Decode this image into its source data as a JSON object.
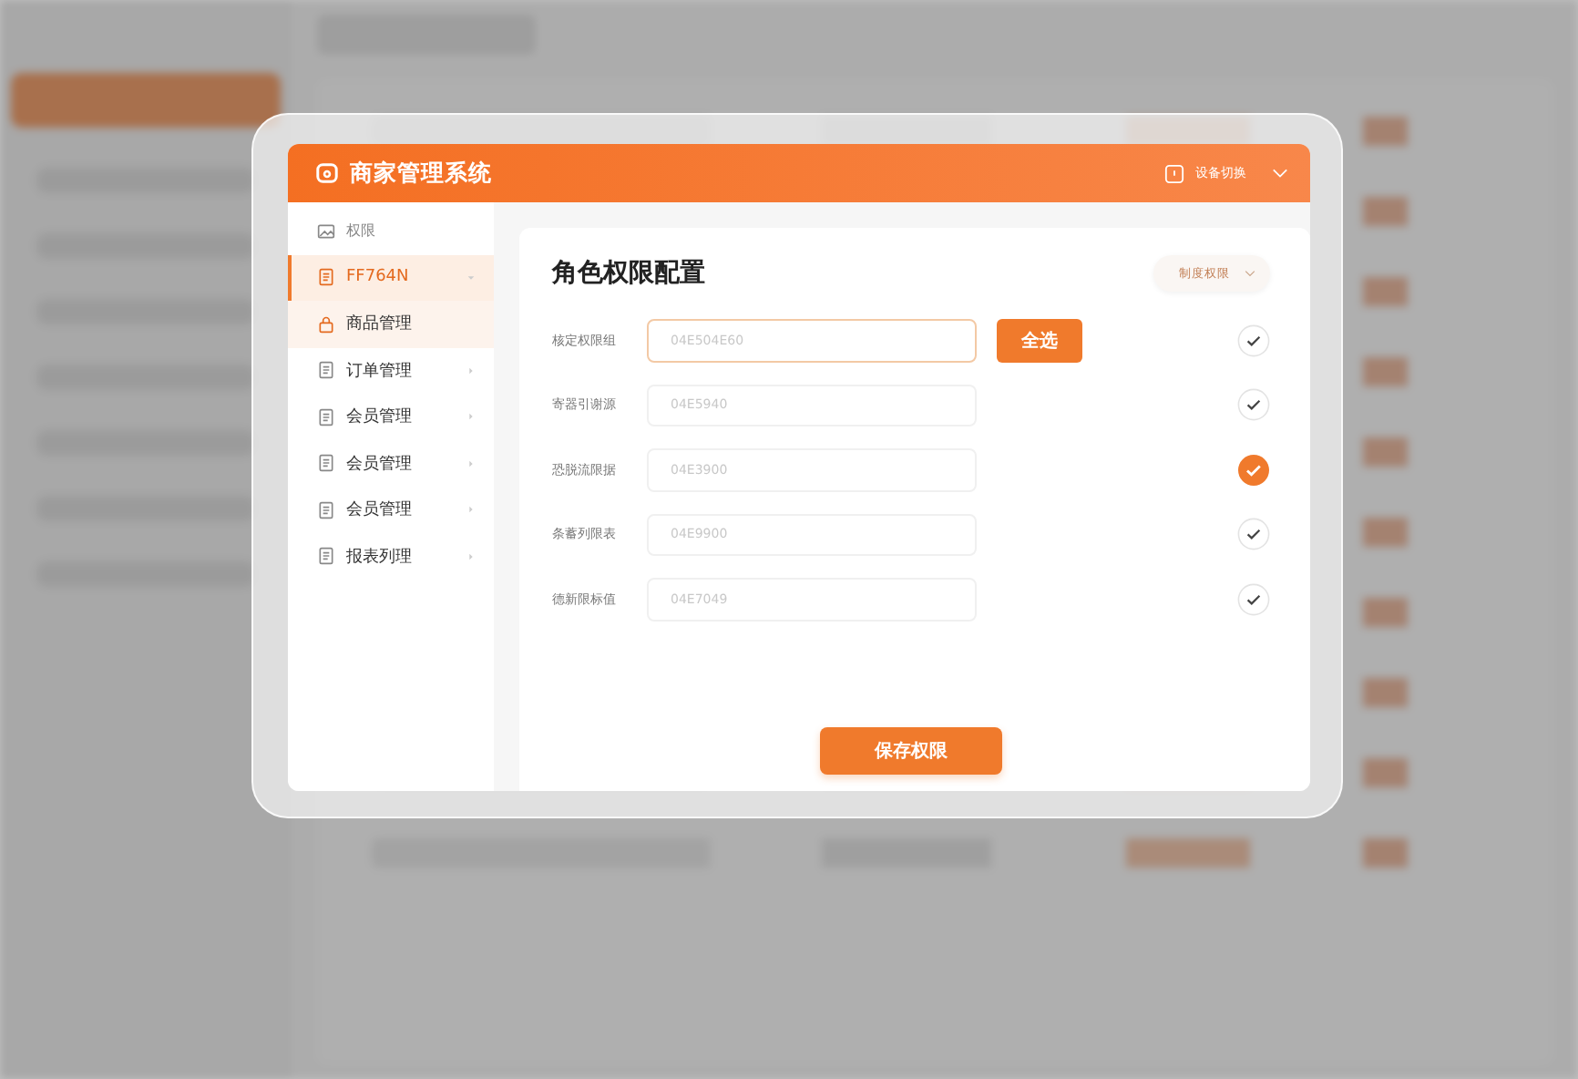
{
  "dialog": {
    "title": "商家管理系统",
    "account_label": "设备切换"
  },
  "sidebar": {
    "items": [
      {
        "label": "权限",
        "kind": "header",
        "selected": false,
        "expanded": false
      },
      {
        "label": "FF764N",
        "kind": "group",
        "selected": false,
        "expanded": true
      },
      {
        "label": "商品管理",
        "kind": "sub",
        "selected": true,
        "expanded": false
      },
      {
        "label": "订单管理",
        "kind": "group",
        "selected": false,
        "expanded": false
      },
      {
        "label": "会员管理",
        "kind": "group",
        "selected": false,
        "expanded": false
      },
      {
        "label": "会员管理",
        "kind": "group",
        "selected": false,
        "expanded": false
      },
      {
        "label": "会员管理",
        "kind": "group",
        "selected": false,
        "expanded": false
      },
      {
        "label": "报表列理",
        "kind": "group",
        "selected": false,
        "expanded": false
      }
    ]
  },
  "panel": {
    "title": "角色权限配置",
    "dropdown": "制度权限",
    "rows": [
      {
        "label": "核定权限组",
        "value": "04E504E60",
        "focused": true,
        "checked": false
      },
      {
        "label": "寄器引谢源",
        "value": "04E5940",
        "focused": false,
        "checked": false
      },
      {
        "label": "恐脱流限据",
        "value": "04E3900",
        "focused": false,
        "checked": true
      },
      {
        "label": "条蓄列限表",
        "value": "04E9900",
        "focused": false,
        "checked": false
      },
      {
        "label": "德新限标值",
        "value": "04E7049",
        "focused": false,
        "checked": false
      }
    ],
    "select_all": "全选",
    "save": "保存权限"
  }
}
